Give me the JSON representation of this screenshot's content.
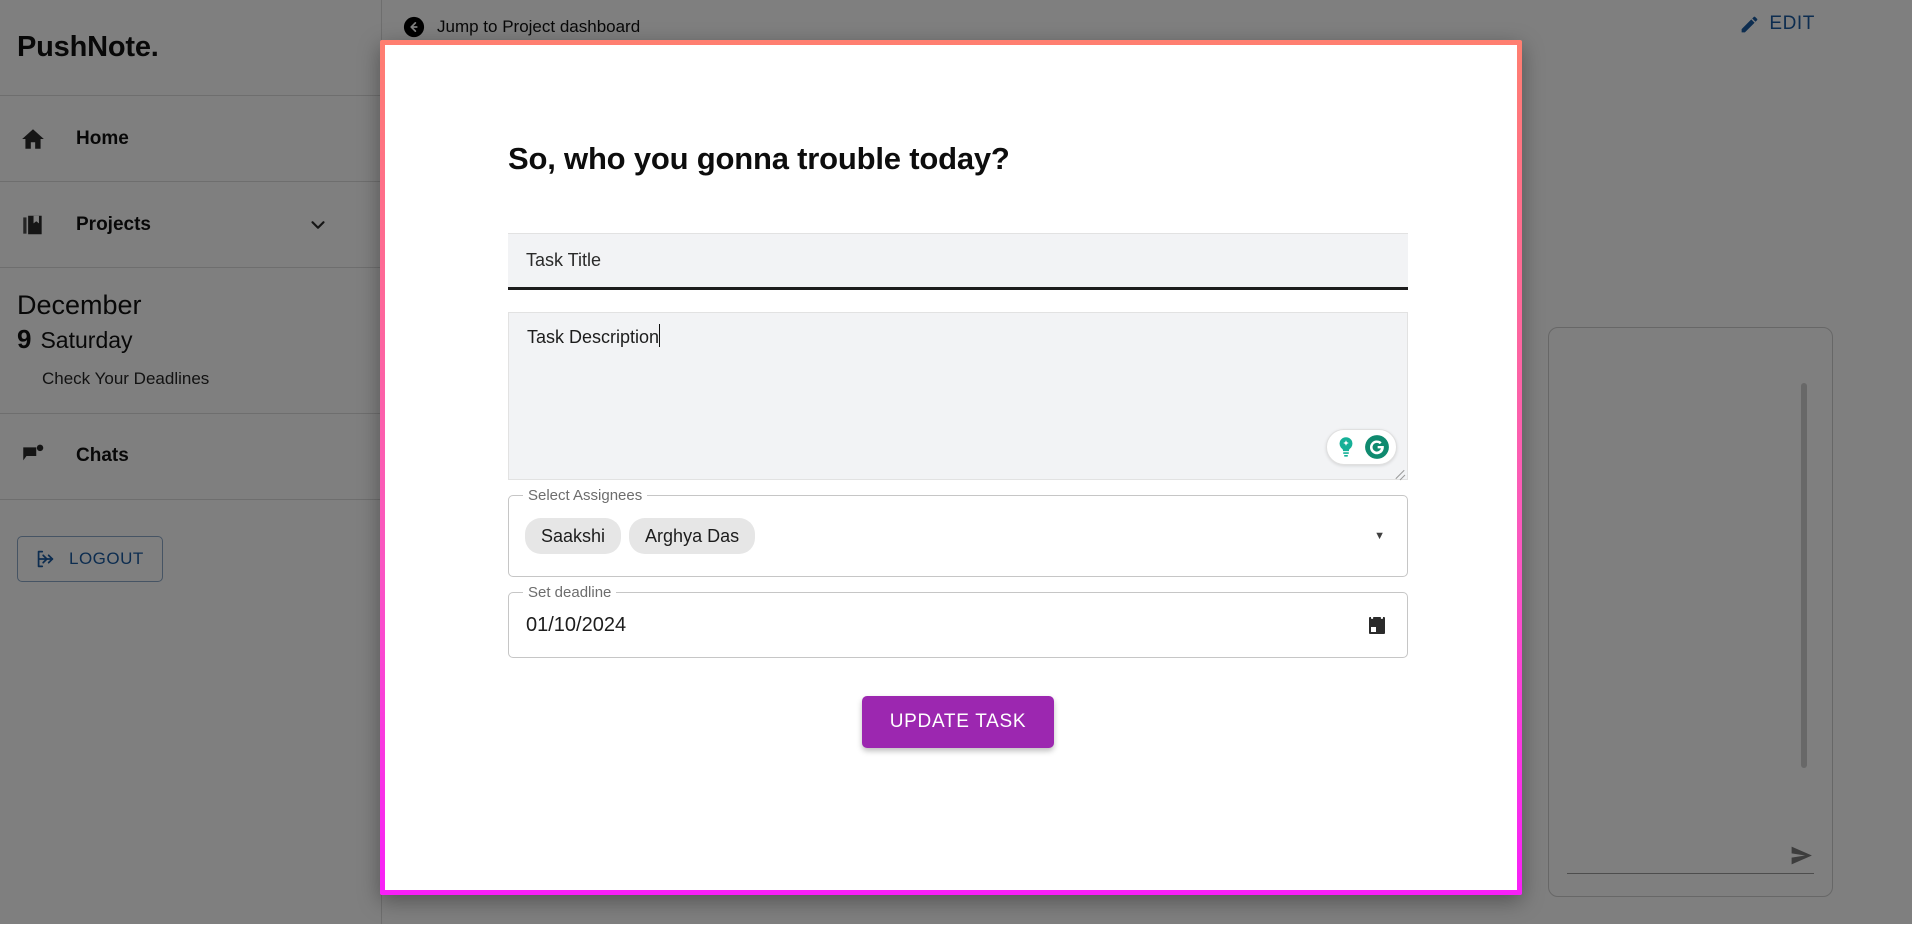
{
  "brand": {
    "name": "PushNote."
  },
  "sidebar": {
    "nav": [
      {
        "label": "Home",
        "icon": "home-icon"
      },
      {
        "label": "Projects",
        "icon": "projects-icon",
        "chevron": "chevron-down-icon"
      }
    ],
    "date": {
      "month": "December",
      "day": "9",
      "weekday": "Saturday",
      "subtitle": "Check Your Deadlines"
    },
    "chats": {
      "label": "Chats",
      "icon": "chat-flag-icon"
    },
    "logout": {
      "label": "LOGOUT",
      "icon": "logout-icon"
    }
  },
  "topbar": {
    "jump_link": "Jump to Project dashboard",
    "jump_icon": "back-arrow-circle-icon",
    "edit_button": "EDIT",
    "edit_icon": "pencil-icon"
  },
  "modal": {
    "title": "So, who you gonna trouble today?",
    "task_title": {
      "placeholder": "Task Title",
      "value": ""
    },
    "task_description": {
      "placeholder": "",
      "value": "Task Description"
    },
    "assignees": {
      "legend": "Select Assignees",
      "chips": [
        "Saakshi",
        "Arghya Das"
      ],
      "dropdown_icon": "caret-down-icon"
    },
    "deadline": {
      "legend": "Set deadline",
      "value": "01/10/2024",
      "icon": "calendar-icon"
    },
    "submit_button": "UPDATE TASK",
    "grammarly": {
      "bulb_icon": "grammarly-bulb-icon",
      "logo_icon": "grammarly-g-icon"
    },
    "border_gradient_from": "#ff7f70",
    "border_gradient_to": "#f81ff8",
    "accent": "#9c27b0"
  },
  "chat_panel": {
    "send_icon": "send-icon",
    "scrollbar": "vertical-scrollbar"
  }
}
